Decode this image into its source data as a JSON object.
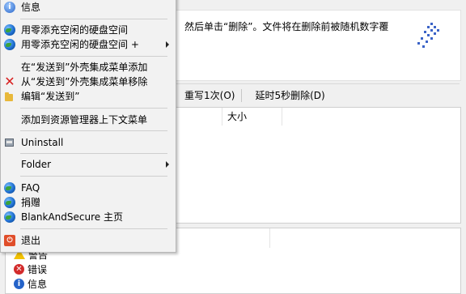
{
  "app": {
    "info_text": "然后单击“删除”。文件将在删除前被随机数字覆",
    "options": [
      "重写1次(O)",
      "延时5秒删除(D)"
    ],
    "file_list": {
      "columns": [
        "大小"
      ]
    },
    "log_entries": [
      {
        "icon": "warning-icon",
        "label": "警告"
      },
      {
        "icon": "error-icon",
        "label": "错误"
      },
      {
        "icon": "info-icon",
        "label": "信息"
      }
    ]
  },
  "menu": {
    "items": [
      {
        "id": "info",
        "label": "信息",
        "icon": "info-icon"
      },
      {
        "id": "fill-free",
        "label": "用零添充空闲的硬盘空间",
        "icon": "globe-icon"
      },
      {
        "id": "fill-free-plus",
        "label": "用零添充空闲的硬盘空间 +",
        "icon": "globe-icon",
        "submenu": true
      },
      {
        "id": "add-sendto",
        "label": "在“发送到”外壳集成菜单添加"
      },
      {
        "id": "remove-sendto",
        "label": "从“发送到”外壳集成菜单移除",
        "icon": "x-icon"
      },
      {
        "id": "edit-sendto",
        "label": "编辑“发送到”",
        "icon": "folder-icon"
      },
      {
        "id": "add-explorer",
        "label": "添加到资源管理器上下文菜单"
      },
      {
        "id": "uninstall",
        "label": "Uninstall",
        "icon": "uninstall-icon"
      },
      {
        "id": "folder",
        "label": "Folder",
        "submenu": true
      },
      {
        "id": "faq",
        "label": "FAQ",
        "icon": "globe-icon"
      },
      {
        "id": "donate",
        "label": "捐赠",
        "icon": "globe-icon"
      },
      {
        "id": "homepage",
        "label": "BlankAndSecure 主页",
        "icon": "globe-icon"
      },
      {
        "id": "exit",
        "label": "退出",
        "icon": "exit-icon"
      }
    ]
  },
  "colors": {
    "menu_bg": "#f2f2f2",
    "error_red": "#d81e1e",
    "warning_yellow": "#f2c200",
    "info_blue": "#2563c9"
  }
}
